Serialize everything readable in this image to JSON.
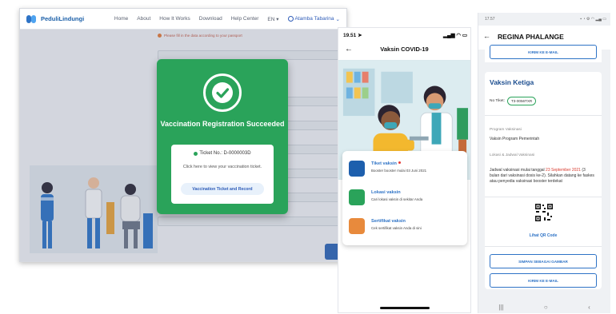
{
  "desktop": {
    "brand": "PeduliLindungi",
    "nav": [
      "Home",
      "About",
      "How It Works",
      "Download",
      "Help Center",
      "EN"
    ],
    "user_name": "Atamba Tabarina",
    "notice": "Please fill in the data according to your passport",
    "modal": {
      "title": "Vaccination Registration Succeeded",
      "ticket_no": "Ticket No.: D-0000003D",
      "description": "Click here to view your vaccination ticket.",
      "button": "Vaccination Ticket and Record"
    }
  },
  "phone1": {
    "time": "19.51",
    "title": "Vaksin COVID-19",
    "items": [
      {
        "title": "Tiket vaksin",
        "subtitle": "Booster booster mulai 03 Juni 2021"
      },
      {
        "title": "Lokasi vaksin",
        "subtitle": "Cari lokasi vaksin di sekitar Anda"
      },
      {
        "title": "Sertifikat vaksin",
        "subtitle": "Cek sertifikat vaksin Anda di sini"
      }
    ],
    "colors": {
      "accent": "#2e73c6"
    }
  },
  "phone2": {
    "time": "17.57",
    "name": "REGINA PHALANGE",
    "email_button_top": "KIRIM KE E-MAIL",
    "vaccine_title": "Vaksin Ketiga",
    "ticket_label": "No Tiket:",
    "ticket_value": "T3-0056TXR",
    "program_label": "Program Vaksinasi",
    "program_value": "Vaksin Program Pemerintah",
    "location_label": "Lokasi & Jadwal Vaksinasi",
    "schedule_before": "Jadwal vaksinasi mulai tanggal ",
    "schedule_date": "23 September 2021",
    "schedule_after": " (3 bulan dari vaksinasi dosis ke-2). Silahkan datang ke faskes atau penyedia vaksinasi booster terdekat",
    "qr_link": "Lihat QR Code",
    "save_button": "SIMPAN SEBAGAI GAMBAR",
    "email_button": "KIRIM KE E-MAIL",
    "nav_icons": [
      "|||",
      "○",
      "‹"
    ]
  },
  "colors": {
    "success": "#2aa35a",
    "primary": "#2e73c6",
    "danger": "#d83a2e"
  }
}
